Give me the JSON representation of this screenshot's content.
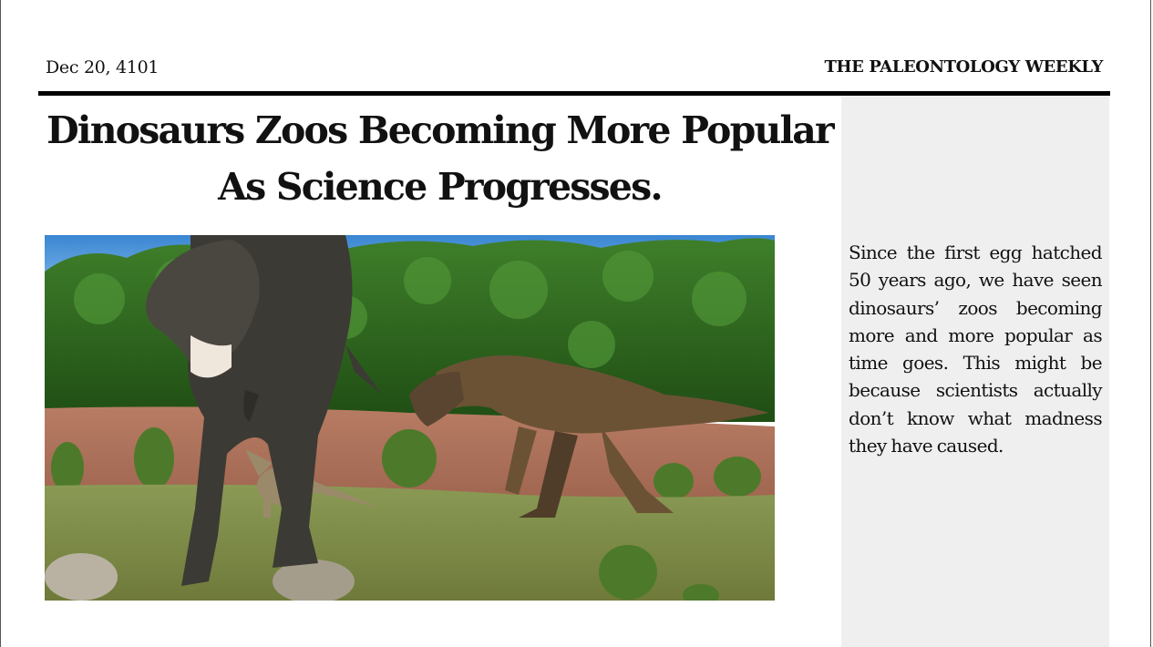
{
  "masthead": {
    "date": "Dec 20, 4101",
    "paper_name": "THE PALEONTOLOGY WEEKLY"
  },
  "article": {
    "headline": "Dinosaurs Zoos Becoming More Popular As Science Progresses.",
    "image": {
      "subject": "dinosaurs-in-zoo-photo",
      "colors": {
        "sky": "#3f8fd6",
        "forest": "#2f6b1f",
        "dirt": "#b0735d",
        "grass": "#8a8f4a",
        "dino_dark": "#3c3a34",
        "dino_brown": "#6e5436"
      }
    }
  },
  "sidebar": {
    "text": "Since the first egg hatched 50 years ago, we have seen dinosaurs’ zoos becoming more and more popular as time goes. This might be because scientists actually don’t know what madness they have caused."
  },
  "colors": {
    "rule": "#000000",
    "sidebar_bg": "#efefef"
  }
}
